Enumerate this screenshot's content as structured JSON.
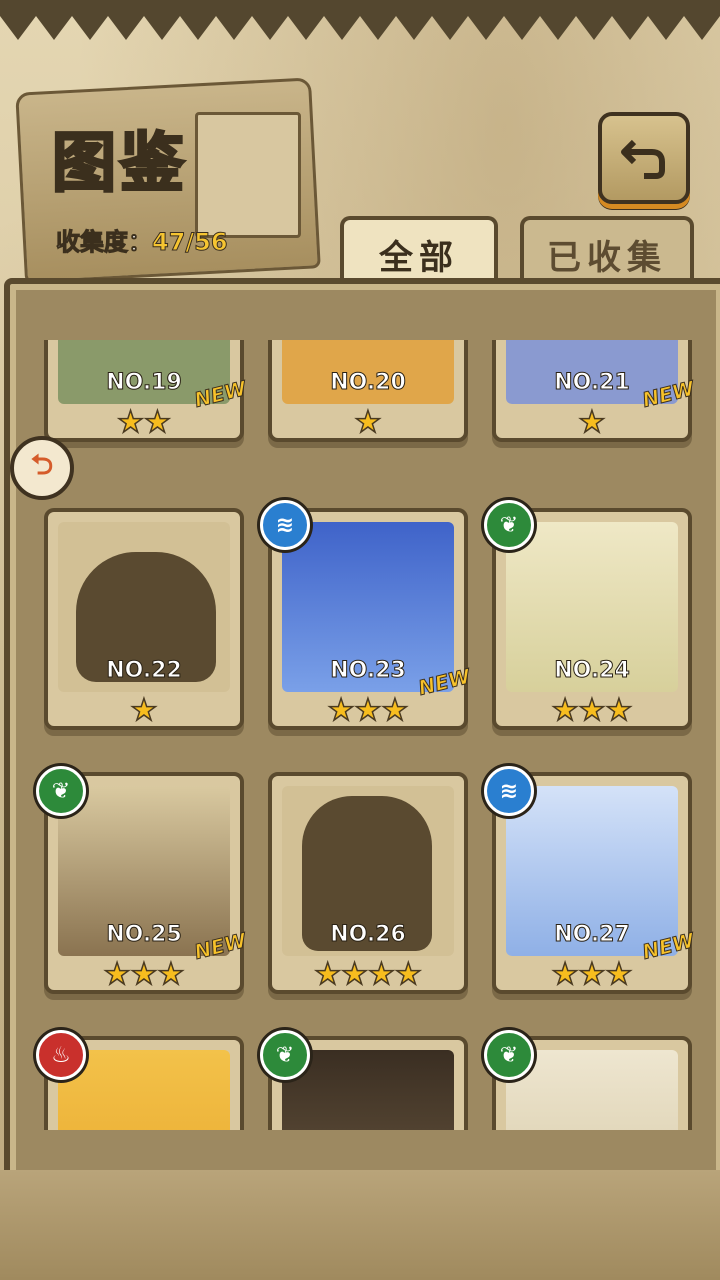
{
  "header": {
    "title": "图鉴",
    "collection_label": "收集度：",
    "collection_value": "47/56"
  },
  "tabs": [
    {
      "label": "全部",
      "active": true
    },
    {
      "label": "已收集",
      "active": false
    }
  ],
  "cards": [
    {
      "number": "NO.19",
      "stars": "★★",
      "new": "NEW",
      "element": null,
      "silhouette": false,
      "art_color": "#8a9a6a"
    },
    {
      "number": "NO.20",
      "stars": "★",
      "new": "",
      "element": null,
      "silhouette": false,
      "art_color": "#e0a64a"
    },
    {
      "number": "NO.21",
      "stars": "★",
      "new": "NEW",
      "element": null,
      "silhouette": false,
      "art_color": "#8a9ad0"
    },
    {
      "number": "NO.22",
      "stars": "★",
      "new": "",
      "element": null,
      "silhouette": true,
      "art_color": "#6b5a3e"
    },
    {
      "number": "NO.23",
      "stars": "★★★",
      "new": "NEW",
      "element": "water",
      "silhouette": false,
      "art_color": "#3f63c9"
    },
    {
      "number": "NO.24",
      "stars": "★★★",
      "new": "",
      "element": "wood",
      "silhouette": false,
      "art_color": "#e7e0b6"
    },
    {
      "number": "NO.25",
      "stars": "★★★",
      "new": "NEW",
      "element": "wood",
      "silhouette": false,
      "art_color": "#2e2a24"
    },
    {
      "number": "NO.26",
      "stars": "★★★★",
      "new": "",
      "element": null,
      "silhouette": true,
      "art_color": "#6b5a3e"
    },
    {
      "number": "NO.27",
      "stars": "★★★",
      "new": "NEW",
      "element": "water",
      "silhouette": false,
      "art_color": "#a9c4ee"
    },
    {
      "number": "",
      "stars": "",
      "new": "",
      "element": "fire",
      "silhouette": false,
      "art_color": "#f3c24a"
    },
    {
      "number": "",
      "stars": "",
      "new": "",
      "element": "wood",
      "silhouette": false,
      "art_color": "#3a2e22"
    },
    {
      "number": "",
      "stars": "",
      "new": "",
      "element": "wood",
      "silhouette": false,
      "art_color": "#e9dfc4"
    }
  ],
  "icons": {
    "back": "back-arrow-icon",
    "side": "left-arrow-icon",
    "water": "water-element-icon",
    "wood": "leaf-element-icon",
    "fire": "fire-element-icon"
  }
}
